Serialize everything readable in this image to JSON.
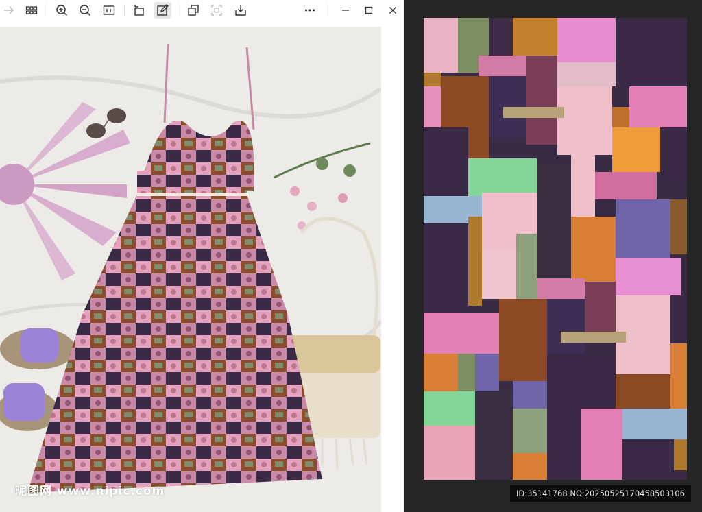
{
  "toolbar": {
    "buttons": [
      {
        "name": "forward-button",
        "icon": "arrow-right-icon",
        "enabled": false
      },
      {
        "name": "grid-view-button",
        "icon": "grid-icon",
        "enabled": true
      },
      {
        "name": "zoom-in-button",
        "icon": "zoom-in-icon",
        "enabled": true
      },
      {
        "name": "zoom-out-button",
        "icon": "zoom-out-icon",
        "enabled": true
      },
      {
        "name": "actual-size-button",
        "icon": "fit-icon",
        "enabled": true
      },
      {
        "name": "rotate-button",
        "icon": "rotate-icon",
        "enabled": true
      },
      {
        "name": "edit-button",
        "icon": "edit-icon",
        "enabled": true,
        "active": true
      },
      {
        "name": "copy-button",
        "icon": "copy-icon",
        "enabled": true
      },
      {
        "name": "crop-button",
        "icon": "crop-icon",
        "enabled": false
      },
      {
        "name": "save-button",
        "icon": "download-icon",
        "enabled": true
      },
      {
        "name": "more-button",
        "icon": "more-icon",
        "enabled": true
      }
    ],
    "window_controls": [
      "minimize-icon",
      "maximize-icon",
      "close-icon"
    ]
  },
  "photo": {
    "watermark": "昵图网 www.nipic.com"
  },
  "preview": {
    "id_caption": "ID:35141768 NO:20250525170458503106"
  },
  "colors": {
    "toolbar_bg": "#ffffff",
    "right_pane_bg": "#262626",
    "caption_bg": "#0d0d0d"
  }
}
